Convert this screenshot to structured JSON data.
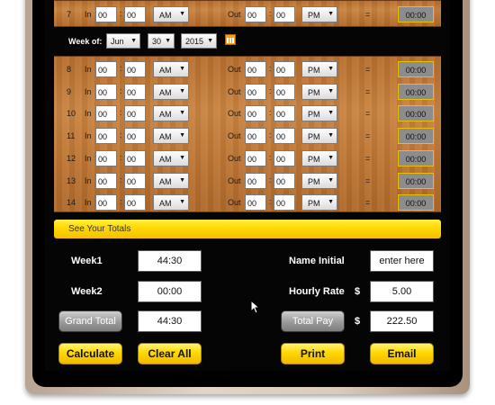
{
  "top_row": {
    "num": "7",
    "in": "In",
    "in_h": "00",
    "in_m": "00",
    "in_ampm": "AM",
    "out": "Out",
    "out_h": "00",
    "out_m": "00",
    "out_ampm": "PM",
    "eq": "=",
    "total": "00:00"
  },
  "week": {
    "label": "Week of:",
    "month": "Jun",
    "day": "30",
    "year": "2015"
  },
  "rows": [
    {
      "num": "8",
      "in": "In",
      "in_h": "00",
      "in_m": "00",
      "in_ampm": "AM",
      "out": "Out",
      "out_h": "00",
      "out_m": "00",
      "out_ampm": "PM",
      "eq": "=",
      "total": "00:00"
    },
    {
      "num": "9",
      "in": "In",
      "in_h": "00",
      "in_m": "00",
      "in_ampm": "AM",
      "out": "Out",
      "out_h": "00",
      "out_m": "00",
      "out_ampm": "PM",
      "eq": "=",
      "total": "00:00"
    },
    {
      "num": "10",
      "in": "In",
      "in_h": "00",
      "in_m": "00",
      "in_ampm": "AM",
      "out": "Out",
      "out_h": "00",
      "out_m": "00",
      "out_ampm": "PM",
      "eq": "=",
      "total": "00:00"
    },
    {
      "num": "11",
      "in": "In",
      "in_h": "00",
      "in_m": "00",
      "in_ampm": "AM",
      "out": "Out",
      "out_h": "00",
      "out_m": "00",
      "out_ampm": "PM",
      "eq": "=",
      "total": "00:00"
    },
    {
      "num": "12",
      "in": "In",
      "in_h": "00",
      "in_m": "00",
      "in_ampm": "AM",
      "out": "Out",
      "out_h": "00",
      "out_m": "00",
      "out_ampm": "PM",
      "eq": "=",
      "total": "00:00"
    },
    {
      "num": "13",
      "in": "In",
      "in_h": "00",
      "in_m": "00",
      "in_ampm": "AM",
      "out": "Out",
      "out_h": "00",
      "out_m": "00",
      "out_ampm": "PM",
      "eq": "=",
      "total": "00:00"
    },
    {
      "num": "14",
      "in": "In",
      "in_h": "00",
      "in_m": "00",
      "in_ampm": "AM",
      "out": "Out",
      "out_h": "00",
      "out_m": "00",
      "out_ampm": "PM",
      "eq": "=",
      "total": "00:00"
    }
  ],
  "totals": {
    "bar_label": "See Your Totals",
    "week1_label": "Week1",
    "week1_value": "44:30",
    "week2_label": "Week2",
    "week2_value": "00:00",
    "grand_total_label": "Grand Total",
    "grand_total_value": "44:30",
    "name_label": "Name Initial",
    "name_value": "enter here",
    "rate_label": "Hourly Rate",
    "rate_currency": "$",
    "rate_value": "5.00",
    "pay_label": "Total Pay",
    "pay_currency": "$",
    "pay_value": "222.50"
  },
  "buttons": {
    "calculate": "Calculate",
    "clear_all": "Clear All",
    "print": "Print",
    "email": "Email"
  },
  "icons": {
    "calendar": "calendar-icon",
    "dropdown": "chevron-down-icon",
    "cursor": "mouse-pointer-icon"
  },
  "colors": {
    "accent_yellow": "#ffd500",
    "wood": "#c07a38",
    "background": "#050505"
  }
}
